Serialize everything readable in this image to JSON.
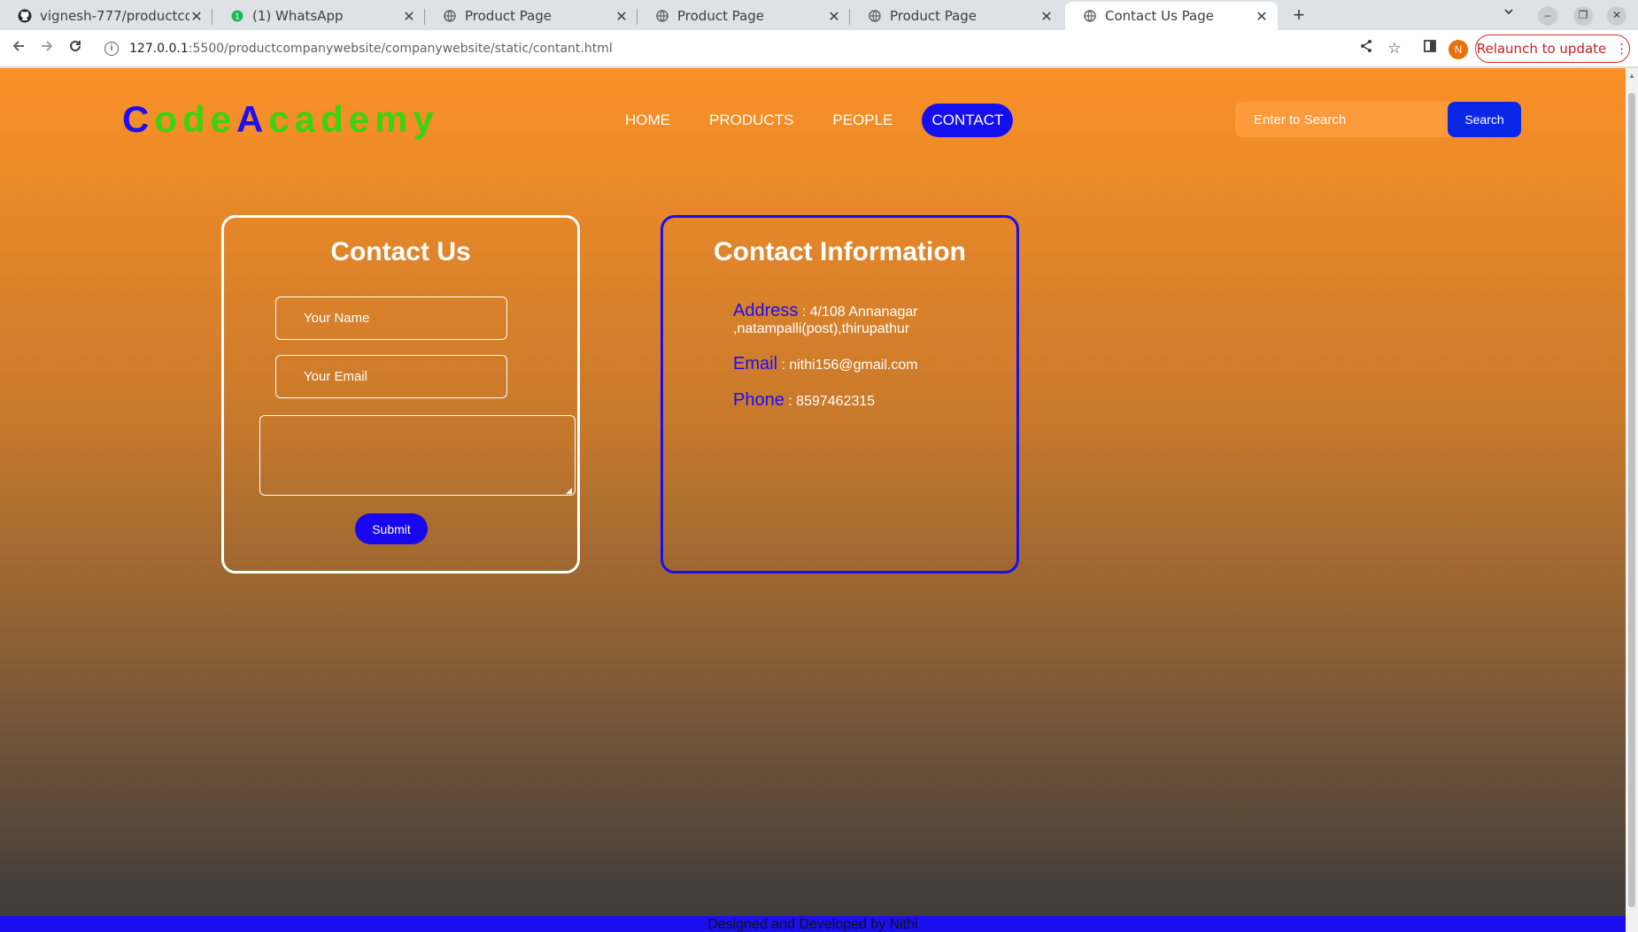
{
  "browser": {
    "tabs": [
      {
        "title": "vignesh-777/productcom",
        "icon": "github-icon"
      },
      {
        "title": "(1) WhatsApp",
        "icon": "whatsapp-icon"
      },
      {
        "title": "Product Page",
        "icon": "globe-icon"
      },
      {
        "title": "Product Page",
        "icon": "globe-icon"
      },
      {
        "title": "Product Page",
        "icon": "globe-icon"
      },
      {
        "title": "Contact Us Page",
        "icon": "globe-icon",
        "active": true
      }
    ],
    "url_host": "127.0.0.1",
    "url_rest": ":5500/productcompanywebsite/companywebsite/static/contant.html",
    "profile_initial": "N",
    "relaunch_label": "Relaunch to update"
  },
  "site": {
    "logo": {
      "part1": "C",
      "part2": "ode",
      "part3": "A",
      "part4": "cademy"
    },
    "nav": [
      {
        "label": "HOME"
      },
      {
        "label": "PRODUCTS"
      },
      {
        "label": "PEOPLE"
      },
      {
        "label": "CONTACT",
        "active": true
      }
    ],
    "search": {
      "placeholder": "Enter to Search",
      "button": "Search"
    },
    "colors": {
      "brand_blue": "#1a0ef0",
      "logo_green": "#39d30f",
      "header_orange": "#fb9127"
    }
  },
  "contact_form": {
    "title": "Contact Us",
    "name_placeholder": "Your Name",
    "email_placeholder": "Your Email",
    "message_value": "",
    "submit_label": "Submit"
  },
  "contact_info": {
    "title": "Contact Information",
    "address_label": "Address",
    "address_value": " : 4/108 Annanagar ,natampalli(post),thirupathur",
    "email_label": "Email",
    "email_value": " : nithi156@gmail.com",
    "phone_label": "Phone",
    "phone_value": " : 8597462315"
  },
  "footer": {
    "text": "Designed and Developed by Nithi"
  }
}
